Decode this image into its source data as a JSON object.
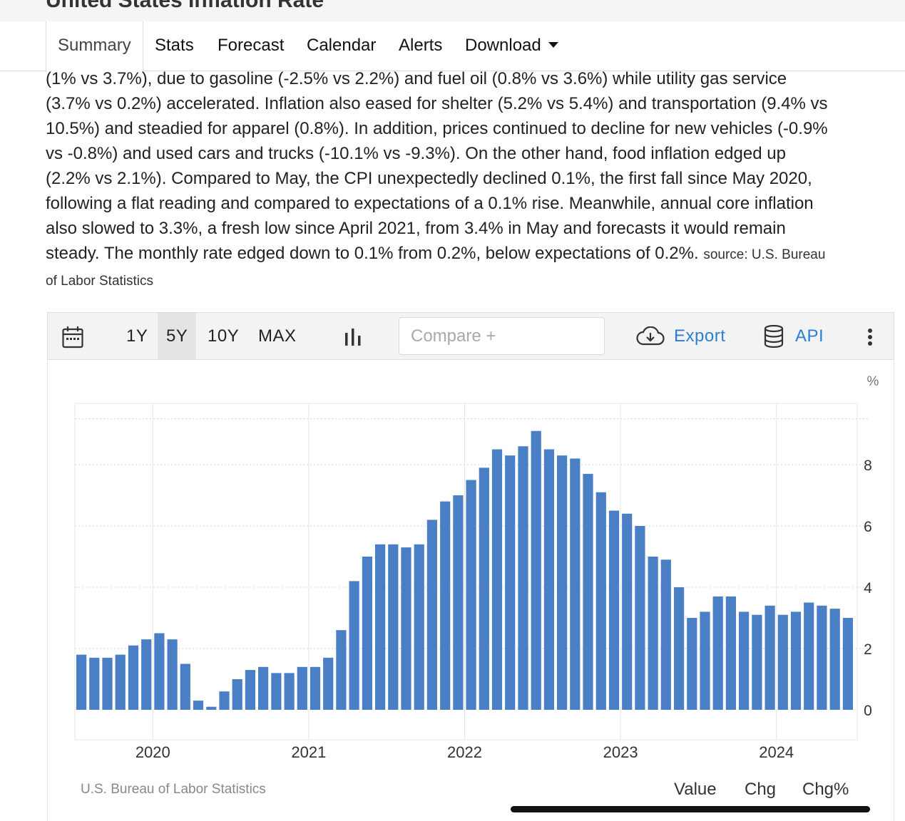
{
  "page": {
    "title": "United States Inflation Rate"
  },
  "tabs": [
    {
      "label": "Summary",
      "active": true
    },
    {
      "label": "Stats"
    },
    {
      "label": "Forecast"
    },
    {
      "label": "Calendar"
    },
    {
      "label": "Alerts"
    },
    {
      "label": "Download"
    }
  ],
  "article": {
    "lines": [
      "(1% vs 3.7%), due to gasoline (-2.5% vs 2.2%) and fuel oil (0.8% vs 3.6%) while utility gas service",
      "(3.7% vs 0.2%) accelerated. Inflation also eased for shelter (5.2% vs 5.4%) and transportation (9.4% vs",
      "10.5%) and steadied for apparel (0.8%). In addition, prices continued to decline for new vehicles (-0.9%",
      "vs -0.8%) and used cars and trucks (-10.1% vs -9.3%). On the other hand, food inflation edged up",
      "(2.2% vs 2.1%). Compared to May, the CPI unexpectedly declined 0.1%, the first fall since May 2020,",
      "following a flat reading and compared to expectations of a 0.1% rise. Meanwhile, annual core inflation",
      "also slowed to 3.3%, a fresh low since April 2021, from 3.4% in May and forecasts it would remain",
      "steady. The monthly rate edged down to 0.1% from 0.2%, below expectations of 0.2%."
    ],
    "source_label": "source: U.S. Bureau",
    "source_label_cont": "of Labor Statistics"
  },
  "toolbar": {
    "ranges": [
      "1Y",
      "5Y",
      "10Y",
      "MAX"
    ],
    "selected_range": "5Y",
    "compare_placeholder": "Compare +",
    "export_label": "Export",
    "api_label": "API"
  },
  "chart_data": {
    "type": "bar",
    "unit_label": "%",
    "ylim": [
      0,
      9.5
    ],
    "yticks": [
      0,
      2,
      4,
      6,
      8
    ],
    "xticks": [
      "2020",
      "2021",
      "2022",
      "2023",
      "2024"
    ],
    "grid": true,
    "color": "#4a7fc5",
    "x": [
      "2019-07",
      "2019-08",
      "2019-09",
      "2019-10",
      "2019-11",
      "2019-12",
      "2020-01",
      "2020-02",
      "2020-03",
      "2020-04",
      "2020-05",
      "2020-06",
      "2020-07",
      "2020-08",
      "2020-09",
      "2020-10",
      "2020-11",
      "2020-12",
      "2021-01",
      "2021-02",
      "2021-03",
      "2021-04",
      "2021-05",
      "2021-06",
      "2021-07",
      "2021-08",
      "2021-09",
      "2021-10",
      "2021-11",
      "2021-12",
      "2022-01",
      "2022-02",
      "2022-03",
      "2022-04",
      "2022-05",
      "2022-06",
      "2022-07",
      "2022-08",
      "2022-09",
      "2022-10",
      "2022-11",
      "2022-12",
      "2023-01",
      "2023-02",
      "2023-03",
      "2023-04",
      "2023-05",
      "2023-06",
      "2023-07",
      "2023-08",
      "2023-09",
      "2023-10",
      "2023-11",
      "2023-12",
      "2024-01",
      "2024-02",
      "2024-03",
      "2024-04",
      "2024-05",
      "2024-06"
    ],
    "values": [
      1.8,
      1.7,
      1.7,
      1.8,
      2.1,
      2.3,
      2.5,
      2.3,
      1.5,
      0.3,
      0.1,
      0.6,
      1.0,
      1.3,
      1.4,
      1.2,
      1.2,
      1.4,
      1.4,
      1.7,
      2.6,
      4.2,
      5.0,
      5.4,
      5.4,
      5.3,
      5.4,
      6.2,
      6.8,
      7.0,
      7.5,
      7.9,
      8.5,
      8.3,
      8.6,
      9.1,
      8.5,
      8.3,
      8.2,
      7.7,
      7.1,
      6.5,
      6.4,
      6.0,
      5.0,
      4.9,
      4.0,
      3.0,
      3.2,
      3.7,
      3.7,
      3.2,
      3.1,
      3.4,
      3.1,
      3.2,
      3.5,
      3.4,
      3.3,
      3.0
    ]
  },
  "footer": {
    "credit": "U.S. Bureau of Labor Statistics",
    "value_tabs": [
      "Value",
      "Chg",
      "Chg%"
    ],
    "active_value_tab": "Value"
  }
}
